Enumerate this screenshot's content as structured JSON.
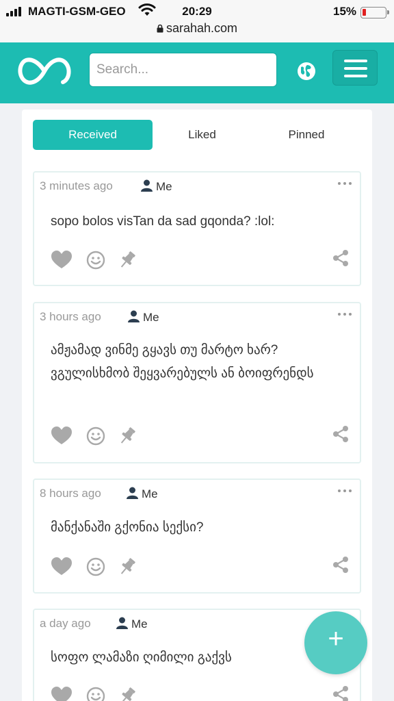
{
  "status_bar": {
    "carrier": "MAGTI-GSM-GEO",
    "time": "20:29",
    "battery_percent": "15%",
    "battery_level": 0.15,
    "url": "sarahah.com"
  },
  "header": {
    "search_placeholder": "Search..."
  },
  "tabs": [
    {
      "label": "Received",
      "active": true
    },
    {
      "label": "Liked",
      "active": false
    },
    {
      "label": "Pinned",
      "active": false
    }
  ],
  "messages": [
    {
      "time": "3 minutes ago",
      "recipient": "Me",
      "text": "sopo bolos visTan da sad gqonda? :lol:"
    },
    {
      "time": "3 hours ago",
      "recipient": "Me",
      "text": "ამჟამად ვინმე გყავს თუ მარტო ხარ? ვგულისხმობ შეყვარებულს ან ბოიფრენდს"
    },
    {
      "time": "8 hours ago",
      "recipient": "Me",
      "text": "მანქანაში გქონია სექსი?"
    },
    {
      "time": "a day ago",
      "recipient": "Me",
      "text": "სოფო ლამაზი ღიმილი გაქვს"
    }
  ],
  "icons": [
    "signal-icon",
    "wifi-icon",
    "lock-icon",
    "battery-icon",
    "logo-icon",
    "globe-icon",
    "menu-icon",
    "user-icon",
    "more-icon",
    "heart-icon",
    "smile-icon",
    "pin-icon",
    "share-icon",
    "plus-icon"
  ],
  "colors": {
    "brand": "#1dbcb2",
    "fab": "#56ccc3",
    "battery_low": "#e02020"
  },
  "fab_label": "+"
}
